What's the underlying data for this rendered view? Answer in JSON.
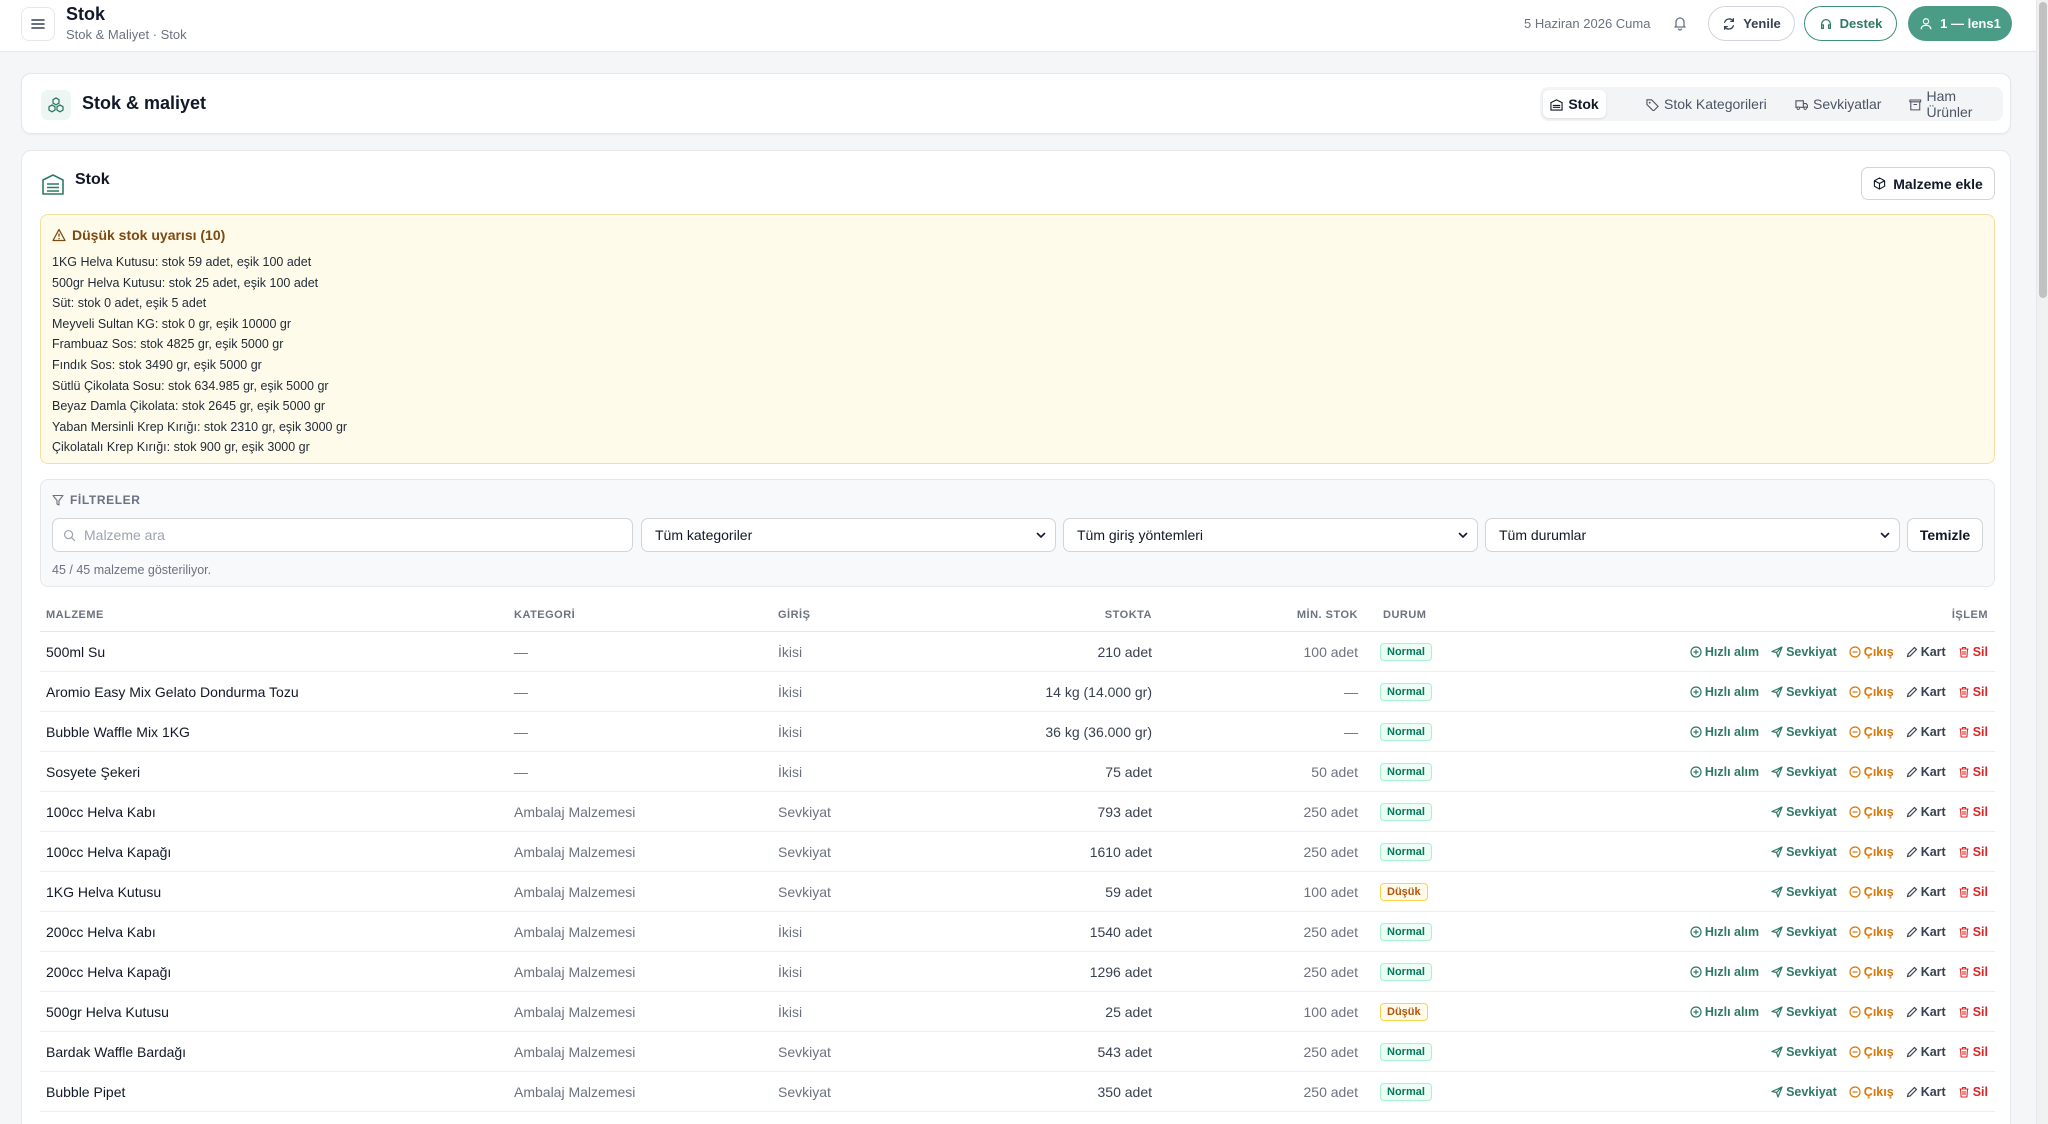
{
  "header": {
    "title": "Stok",
    "breadcrumb": "Stok & Maliyet · Stok",
    "date": "5 Haziran 2026 Cuma",
    "refresh_label": "Yenile",
    "support_label": "Destek",
    "user_label": "1 — lens1"
  },
  "section": {
    "title": "Stok & maliyet",
    "tabs": [
      {
        "label": "Stok"
      },
      {
        "label": "Stok Kategorileri"
      },
      {
        "label": "Sevkiyatlar"
      },
      {
        "label": "Ham Ürünler"
      }
    ]
  },
  "main": {
    "title": "Stok",
    "add_label": "Malzeme ekle"
  },
  "alert": {
    "title": "Düşük stok uyarısı (10)",
    "items": [
      "1KG Helva Kutusu: stok 59 adet, eşik 100 adet",
      "500gr Helva Kutusu: stok 25 adet, eşik 100 adet",
      "Süt: stok 0 adet, eşik 5 adet",
      "Meyveli Sultan KG: stok 0 gr, eşik 10000 gr",
      "Frambuaz Sos: stok 4825 gr, eşik 5000 gr",
      "Fındık Sos: stok 3490 gr, eşik 5000 gr",
      "Sütlü Çikolata Sosu: stok 634.985 gr, eşik 5000 gr",
      "Beyaz Damla Çikolata: stok 2645 gr, eşik 5000 gr",
      "Yaban Mersinli Krep Kırığı: stok 2310 gr, eşik 3000 gr",
      "Çikolatalı Krep Kırığı: stok 900 gr, eşik 3000 gr"
    ]
  },
  "filters": {
    "label": "FİLTRELER",
    "search_placeholder": "Malzeme ara",
    "category": "Tüm kategoriler",
    "entry_method": "Tüm giriş yöntemleri",
    "status": "Tüm durumlar",
    "clear_label": "Temizle",
    "count_text": "45 / 45 malzeme gösteriliyor."
  },
  "table": {
    "headers": {
      "name": "MALZEME",
      "category": "KATEGORİ",
      "entry": "GİRİŞ",
      "stock": "STOKTA",
      "min_stock": "MİN. STOK",
      "status": "DURUM",
      "action": "İŞLEM"
    },
    "action_labels": {
      "quick_buy": "Hızlı alım",
      "ship": "Sevkiyat",
      "out": "Çıkış",
      "card": "Kart",
      "delete": "Sil"
    },
    "rows": [
      {
        "name": "500ml Su",
        "category": "—",
        "entry": "İkisi",
        "stock": "210 adet",
        "min": "100 adet",
        "status": "Normal",
        "quick": true
      },
      {
        "name": "Aromio Easy Mix Gelato Dondurma Tozu",
        "category": "—",
        "entry": "İkisi",
        "stock": "14 kg (14.000 gr)",
        "min": "—",
        "status": "Normal",
        "quick": true
      },
      {
        "name": "Bubble Waffle Mix 1KG",
        "category": "—",
        "entry": "İkisi",
        "stock": "36 kg (36.000 gr)",
        "min": "—",
        "status": "Normal",
        "quick": true
      },
      {
        "name": "Sosyete Şekeri",
        "category": "—",
        "entry": "İkisi",
        "stock": "75 adet",
        "min": "50 adet",
        "status": "Normal",
        "quick": true
      },
      {
        "name": "100cc Helva Kabı",
        "category": "Ambalaj Malzemesi",
        "entry": "Sevkiyat",
        "stock": "793 adet",
        "min": "250 adet",
        "status": "Normal",
        "quick": false
      },
      {
        "name": "100cc Helva Kapağı",
        "category": "Ambalaj Malzemesi",
        "entry": "Sevkiyat",
        "stock": "1610 adet",
        "min": "250 adet",
        "status": "Normal",
        "quick": false
      },
      {
        "name": "1KG Helva Kutusu",
        "category": "Ambalaj Malzemesi",
        "entry": "Sevkiyat",
        "stock": "59 adet",
        "min": "100 adet",
        "status": "Düşük",
        "quick": false
      },
      {
        "name": "200cc Helva Kabı",
        "category": "Ambalaj Malzemesi",
        "entry": "İkisi",
        "stock": "1540 adet",
        "min": "250 adet",
        "status": "Normal",
        "quick": true
      },
      {
        "name": "200cc Helva Kapağı",
        "category": "Ambalaj Malzemesi",
        "entry": "İkisi",
        "stock": "1296 adet",
        "min": "250 adet",
        "status": "Normal",
        "quick": true
      },
      {
        "name": "500gr Helva Kutusu",
        "category": "Ambalaj Malzemesi",
        "entry": "İkisi",
        "stock": "25 adet",
        "min": "100 adet",
        "status": "Düşük",
        "quick": true
      },
      {
        "name": "Bardak Waffle Bardağı",
        "category": "Ambalaj Malzemesi",
        "entry": "Sevkiyat",
        "stock": "543 adet",
        "min": "250 adet",
        "status": "Normal",
        "quick": false
      },
      {
        "name": "Bubble Pipet",
        "category": "Ambalaj Malzemesi",
        "entry": "Sevkiyat",
        "stock": "350 adet",
        "min": "250 adet",
        "status": "Normal",
        "quick": false
      }
    ]
  },
  "colors": {
    "accent": "#4a9c86",
    "warning_bg": "#fefbea",
    "danger": "#dc2626",
    "orange": "#d97706"
  }
}
